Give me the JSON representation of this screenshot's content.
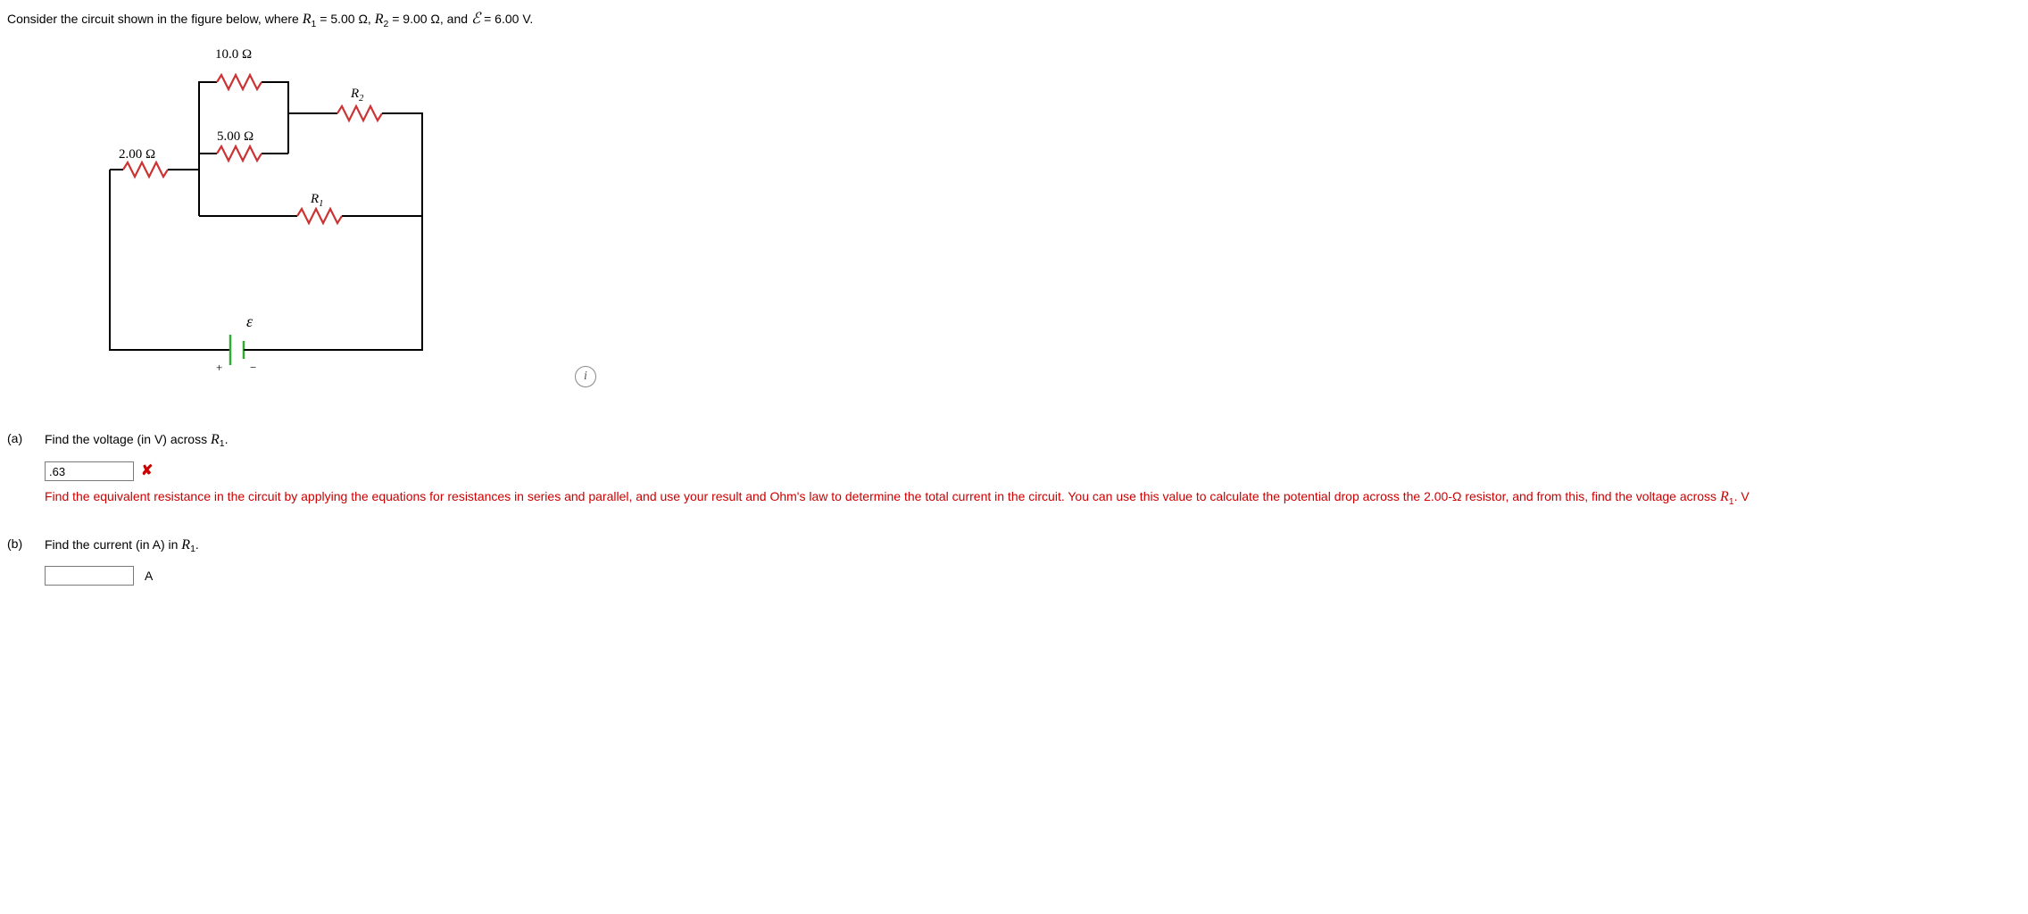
{
  "problem": {
    "intro_a": "Consider the circuit shown in the figure below, where ",
    "R1_sym": "R",
    "R1_sub": "1",
    "eq1": " = 5.00 Ω, ",
    "R2_sym": "R",
    "R2_sub": "2",
    "eq2": " = 9.00 Ω, and ",
    "emf_sym": "ℰ",
    "eq3": " = 6.00 V."
  },
  "labels": {
    "r10": "10.0 Ω",
    "r5": "5.00 Ω",
    "r2": "2.00 Ω",
    "R2": "R",
    "R2sub": "2",
    "R1": "R",
    "R1sub": "1",
    "emf": "ε",
    "plus": "+",
    "minus": "−"
  },
  "info_icon": "i",
  "parts": {
    "a": {
      "label": "(a)",
      "prompt_a": "Find the voltage (in V) across ",
      "prompt_R": "R",
      "prompt_sub": "1",
      "prompt_end": ".",
      "answer_value": ".63",
      "wrong_mark": "✘",
      "feedback_a": "Find the equivalent resistance in the circuit by applying the equations for resistances in series and parallel, and use your result and Ohm's law to determine the total current in the circuit. You can use this value to calculate the potential drop across the 2.00-Ω resistor, and from this, find the voltage across ",
      "feedback_R": "R",
      "feedback_sub": "1",
      "feedback_end": ". V"
    },
    "b": {
      "label": "(b)",
      "prompt_a": "Find the current (in A) in ",
      "prompt_R": "R",
      "prompt_sub": "1",
      "prompt_end": ".",
      "unit": "A"
    }
  }
}
